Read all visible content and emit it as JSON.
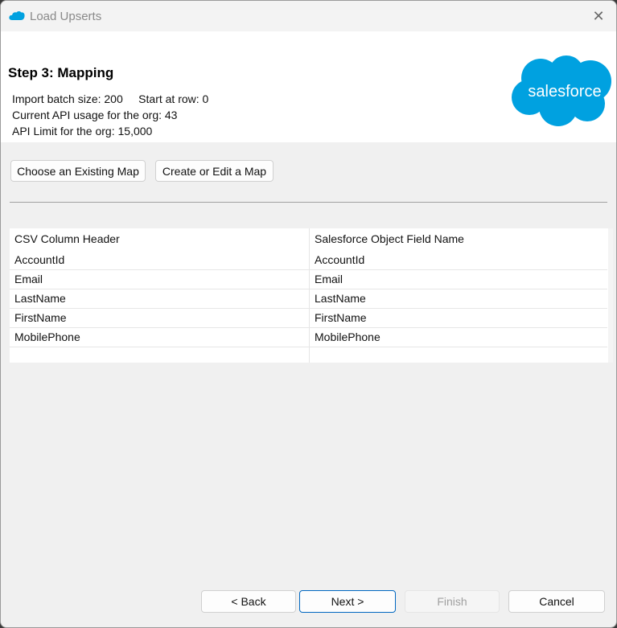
{
  "window": {
    "title": "Load Upserts",
    "close_icon": "close-icon"
  },
  "header": {
    "step_title": "Step 3: Mapping",
    "batch_info": "Import batch size: 200     Start at row: 0",
    "api_usage": "Current API usage for the org: 43",
    "api_limit": "API Limit for the org: 15,000",
    "logo_text": "salesforce",
    "brand_color": "#00A1E0"
  },
  "map_buttons": {
    "choose_existing": "Choose an Existing Map",
    "create_edit": "Create or Edit a Map"
  },
  "mapping_table": {
    "headers": [
      "CSV Column Header",
      "Salesforce Object Field Name"
    ],
    "rows": [
      [
        "AccountId",
        "AccountId"
      ],
      [
        "Email",
        "Email"
      ],
      [
        "LastName",
        "LastName"
      ],
      [
        "FirstName",
        "FirstName"
      ],
      [
        "MobilePhone",
        "MobilePhone"
      ],
      [
        "",
        ""
      ]
    ]
  },
  "footer": {
    "back": "< Back",
    "next": "Next >",
    "finish": "Finish",
    "cancel": "Cancel"
  }
}
